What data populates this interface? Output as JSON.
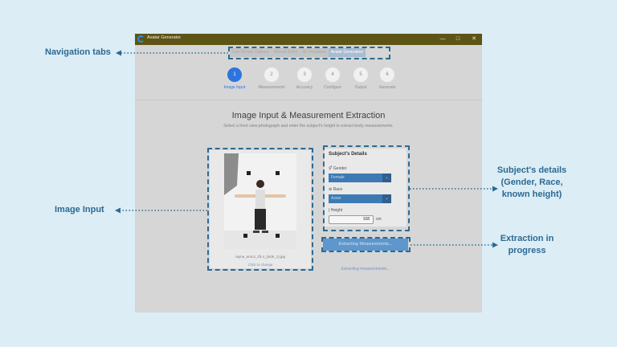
{
  "window": {
    "title": "Avatar Generator",
    "controls": {
      "minimize": "—",
      "maximize": "□",
      "close": "✕"
    }
  },
  "tabs": [
    {
      "label": "Live Stream Capture",
      "active": false
    },
    {
      "label": "Manual Entry",
      "active": false
    },
    {
      "label": "3D Visualizer",
      "active": false
    },
    {
      "label": "Avatar Generation",
      "active": true
    }
  ],
  "steps": [
    {
      "number": "1",
      "label": "Image Input",
      "active": true
    },
    {
      "number": "2",
      "label": "Measurements",
      "active": false
    },
    {
      "number": "3",
      "label": "Accuracy",
      "active": false
    },
    {
      "number": "4",
      "label": "Configure",
      "active": false
    },
    {
      "number": "5",
      "label": "Output",
      "active": false
    },
    {
      "number": "6",
      "label": "Generate",
      "active": false
    }
  ],
  "page": {
    "title": "Image Input & Measurement Extraction",
    "subtitle": "Select a front view photograph and enter the subject's height to extract body measurements."
  },
  "image_input": {
    "file_name": "rayne_arocs_1ft.4_(side_1).jpg",
    "change_hint": "Click to change"
  },
  "subject": {
    "title": "Subject's Details",
    "gender_label": "Gender",
    "gender_value": "Female",
    "race_label": "Race",
    "race_value": "Asian",
    "height_label": "Height",
    "height_value": "168",
    "height_unit": "cm"
  },
  "extraction": {
    "button_label": "Extracting Measurements...",
    "status_text": "Extracting measurements..."
  },
  "annotations": {
    "nav_tabs": "Navigation tabs",
    "image_input": "Image Input",
    "subject_details": "Subject's details (Gender, Race, known height)",
    "extraction": "Extraction in progress"
  },
  "colors": {
    "accent": "#2d74e0",
    "annotation": "#2c6a93",
    "titlebar": "#5e5415",
    "select_bg": "#3d7ab4"
  },
  "icons": {
    "gender": "gender-icon",
    "race": "globe-icon",
    "height": "ruler-icon"
  }
}
